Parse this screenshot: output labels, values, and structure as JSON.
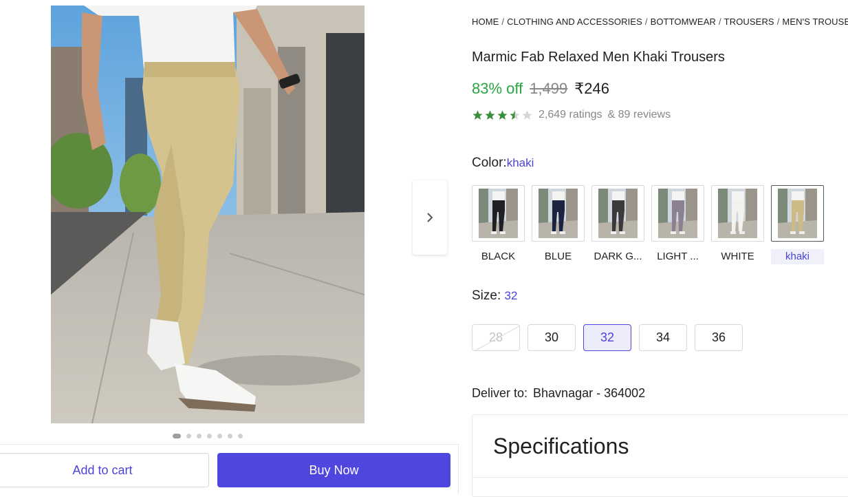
{
  "gallery": {
    "dots_count": 7,
    "active_dot": 0
  },
  "actions": {
    "add_to_cart": "Add to cart",
    "buy_now": "Buy Now"
  },
  "breadcrumb": [
    "HOME",
    "CLOTHING AND ACCESSORIES",
    "BOTTOMWEAR",
    "TROUSERS",
    "MEN'S TROUSERS"
  ],
  "product": {
    "title": "Marmic Fab Relaxed Men Khaki Trousers",
    "discount": "83% off",
    "mrp": "1,499",
    "price": "₹246",
    "rating_stars": 3.5,
    "ratings": "2,649 ratings",
    "reviews": "& 89 reviews"
  },
  "color": {
    "label": "Color:",
    "selected": "khaki",
    "options": [
      {
        "name": "BLACK",
        "pant_color": "#1f1f24"
      },
      {
        "name": "BLUE",
        "pant_color": "#1c2340"
      },
      {
        "name": "DARK G...",
        "pant_color": "#3a3a3c"
      },
      {
        "name": "LIGHT ...",
        "pant_color": "#8c8190"
      },
      {
        "name": "WHITE",
        "pant_color": "#f2f2ee"
      },
      {
        "name": "khaki",
        "pant_color": "#cdbb86"
      }
    ]
  },
  "size": {
    "label": "Size:",
    "selected": "32",
    "options": [
      "28",
      "30",
      "32",
      "34",
      "36"
    ]
  },
  "delivery": {
    "label": "Deliver to:",
    "location": "Bhavnagar - 364002"
  },
  "specifications": {
    "title": "Specifications"
  },
  "colors": {
    "accent": "#4f46e0",
    "discount_green": "#26a541",
    "star_green": "#388e3c"
  }
}
